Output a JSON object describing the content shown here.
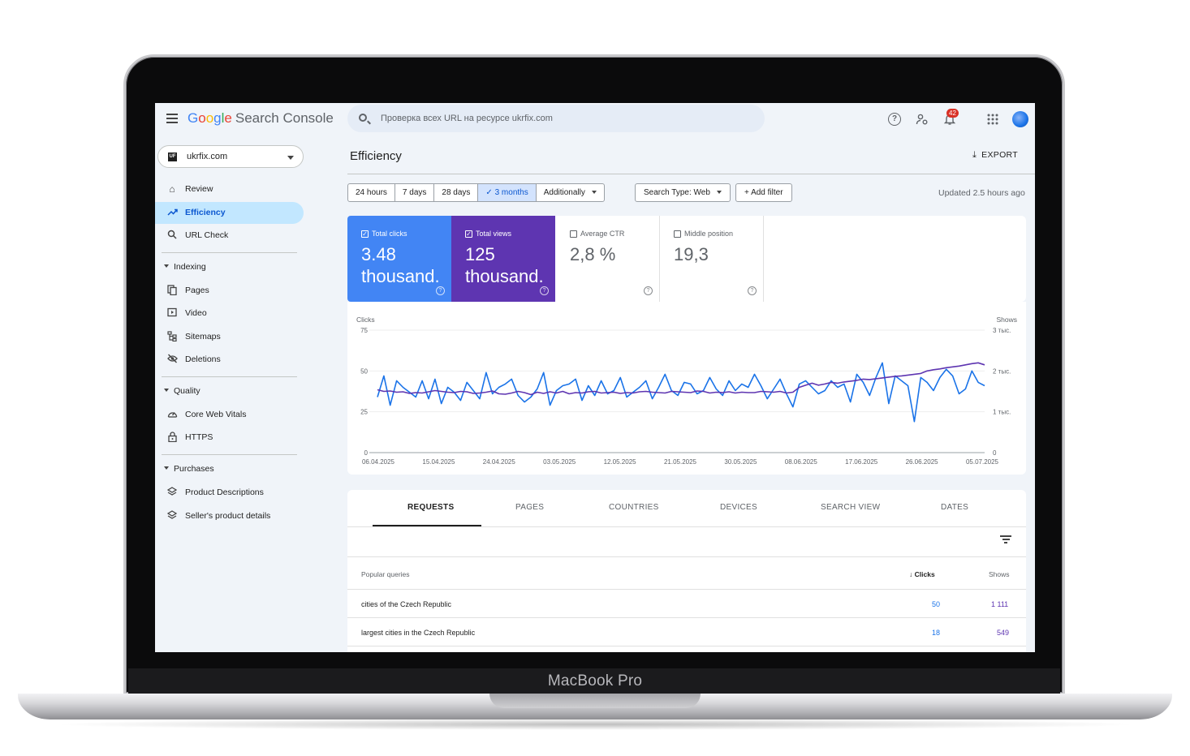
{
  "device": {
    "label": "MacBook Pro"
  },
  "header": {
    "logo": {
      "g1": "G",
      "g2": "o",
      "g3": "o",
      "g1b": "g",
      "g4": "l",
      "g2b": "e",
      "product": "Search Console"
    },
    "search_placeholder": "Проверка всех URL на ресурсе ukrfix.com",
    "notification_count": "42",
    "icons": [
      "menu-icon",
      "search-icon",
      "help-icon",
      "user-gear-icon",
      "bell-icon",
      "apps-grid-icon",
      "avatar"
    ]
  },
  "sidebar": {
    "property": "ukrfix.com",
    "property_logo": "UF",
    "items": [
      {
        "label": "Review",
        "icon": "home-icon"
      },
      {
        "label": "Efficiency",
        "icon": "trending-up-icon",
        "active": true
      },
      {
        "label": "URL Check",
        "icon": "search-icon"
      }
    ],
    "sections": [
      {
        "label": "Indexing",
        "items": [
          {
            "label": "Pages",
            "icon": "pages-icon"
          },
          {
            "label": "Video",
            "icon": "video-icon"
          },
          {
            "label": "Sitemaps",
            "icon": "sitemap-icon"
          },
          {
            "label": "Deletions",
            "icon": "visibility-off-icon"
          }
        ]
      },
      {
        "label": "Quality",
        "items": [
          {
            "label": "Core Web Vitals",
            "icon": "speed-icon"
          },
          {
            "label": "HTTPS",
            "icon": "lock-icon"
          }
        ]
      },
      {
        "label": "Purchases",
        "items": [
          {
            "label": "Product Descriptions",
            "icon": "layers-icon"
          },
          {
            "label": "Seller's product details",
            "icon": "layers-icon"
          }
        ]
      }
    ]
  },
  "main": {
    "title": "Efficiency",
    "export_label": "EXPORT",
    "ranges": [
      "24 hours",
      "7 days",
      "28 days",
      "3 months",
      "Additionally"
    ],
    "selected_range": "3 months",
    "search_type": "Search Type: Web",
    "add_filter": "Add filter",
    "updated": "Updated 2.5 hours ago",
    "metrics": [
      {
        "label": "Total clicks",
        "value": "3.48\nthousand.",
        "checked": true,
        "color": "#4285f4"
      },
      {
        "label": "Total views",
        "value": "125\nthousand.",
        "checked": true,
        "color": "#5e35b1"
      },
      {
        "label": "Average CTR",
        "value": "2,8 %",
        "checked": false
      },
      {
        "label": "Middle position",
        "value": "19,3",
        "checked": false
      }
    ]
  },
  "chart_data": {
    "type": "line",
    "left_axis": {
      "title": "Clicks",
      "ticks": [
        "75",
        "50",
        "25",
        "0"
      ],
      "ylim": [
        0,
        75
      ]
    },
    "right_axis": {
      "title": "Shows",
      "ticks": [
        "3 тыс.",
        "2 тыс.",
        "1 тыс.",
        "0"
      ],
      "ylim": [
        0,
        3000
      ]
    },
    "x_ticks": [
      "06.04.2025",
      "15.04.2025",
      "24.04.2025",
      "03.05.2025",
      "12.05.2025",
      "21.05.2025",
      "30.05.2025",
      "08.06.2025",
      "17.06.2025",
      "26.06.2025",
      "05.07.2025"
    ],
    "n_points": 96,
    "series": [
      {
        "name": "Total clicks",
        "axis": "left",
        "color": "#1a73e8",
        "values": [
          34,
          47,
          29,
          44,
          40,
          37,
          34,
          44,
          33,
          45,
          30,
          40,
          37,
          32,
          43,
          38,
          33,
          49,
          36,
          40,
          42,
          45,
          35,
          31,
          34,
          39,
          49,
          29,
          38,
          41,
          42,
          45,
          32,
          41,
          35,
          44,
          36,
          38,
          46,
          34,
          37,
          40,
          44,
          33,
          40,
          48,
          38,
          35,
          43,
          42,
          36,
          38,
          46,
          39,
          35,
          44,
          38,
          42,
          40,
          48,
          41,
          33,
          39,
          45,
          36,
          28,
          42,
          44,
          40,
          36,
          38,
          44,
          40,
          42,
          31,
          48,
          43,
          35,
          46,
          55,
          30,
          47,
          44,
          41,
          19,
          46,
          43,
          38,
          46,
          51,
          47,
          36,
          39,
          50,
          43,
          41
        ]
      },
      {
        "name": "Total views",
        "axis": "right",
        "color": "#5e35b1",
        "values": [
          1540,
          1500,
          1510,
          1480,
          1490,
          1450,
          1470,
          1460,
          1490,
          1520,
          1500,
          1480,
          1470,
          1500,
          1490,
          1450,
          1460,
          1480,
          1510,
          1440,
          1430,
          1460,
          1500,
          1470,
          1420,
          1480,
          1450,
          1490,
          1460,
          1500,
          1440,
          1470,
          1460,
          1490,
          1500,
          1460,
          1470,
          1480,
          1450,
          1470,
          1460,
          1490,
          1500,
          1480,
          1470,
          1460,
          1500,
          1490,
          1480,
          1470,
          1510,
          1500,
          1460,
          1480,
          1470,
          1490,
          1460,
          1480,
          1470,
          1470,
          1500,
          1490,
          1480,
          1500,
          1460,
          1480,
          1600,
          1650,
          1700,
          1650,
          1680,
          1720,
          1700,
          1730,
          1750,
          1770,
          1800,
          1790,
          1810,
          1830,
          1850,
          1870,
          1880,
          1900,
          1920,
          1940,
          2000,
          2030,
          2050,
          2080,
          2100,
          2120,
          2150,
          2180,
          2200,
          2150
        ]
      }
    ]
  },
  "table": {
    "tabs": [
      "REQUESTS",
      "PAGES",
      "COUNTRIES",
      "DEVICES",
      "SEARCH VIEW",
      "DATES"
    ],
    "active_tab": "REQUESTS",
    "columns": {
      "query": "Popular queries",
      "clicks": "Clicks",
      "shows": "Shows"
    },
    "rows": [
      {
        "query": "cities of the Czech Republic",
        "clicks": "50",
        "shows": "1 111"
      },
      {
        "query": "largest cities in the Czech Republic",
        "clicks": "18",
        "shows": "549"
      }
    ]
  }
}
